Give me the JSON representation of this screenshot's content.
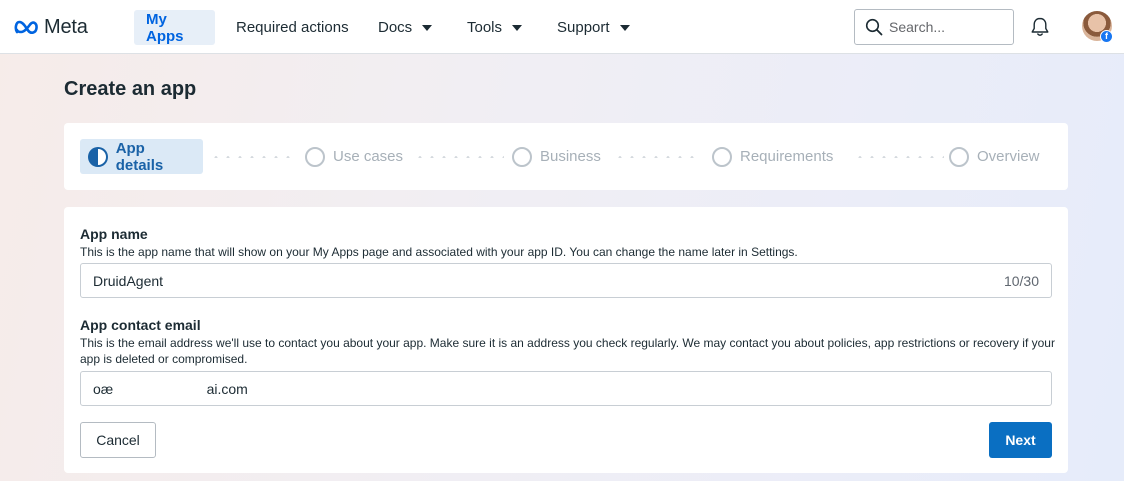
{
  "topnav": {
    "logo_text": "Meta",
    "items": [
      {
        "label": "My Apps"
      },
      {
        "label": "Required actions"
      },
      {
        "label": "Docs"
      },
      {
        "label": "Tools"
      },
      {
        "label": "Support"
      }
    ],
    "search_placeholder": "Search...",
    "icons": {
      "search": "search-icon",
      "bell": "bell-icon",
      "avatar": "avatar",
      "badge": "facebook-icon"
    },
    "badge_text": "f"
  },
  "page": {
    "title": "Create an app"
  },
  "stepper": {
    "steps": [
      {
        "label": "App details",
        "state": "active"
      },
      {
        "label": "Use cases",
        "state": "pending"
      },
      {
        "label": "Business",
        "state": "pending"
      },
      {
        "label": "Requirements",
        "state": "pending"
      },
      {
        "label": "Overview",
        "state": "pending"
      }
    ]
  },
  "form": {
    "app_name": {
      "label": "App name",
      "help": "This is the app name that will show on your My Apps page and associated with your app ID. You can change the name later in Settings.",
      "value": "DruidAgent",
      "counter": "10/30"
    },
    "contact_email": {
      "label": "App contact email",
      "help": "This is the email address we'll use to contact you about your app. Make sure it is an address you check regularly. We may contact you about policies, app restrictions or recovery if your app is deleted or compromised.",
      "value": "oæ                        ai.com"
    },
    "cancel_label": "Cancel",
    "next_label": "Next"
  },
  "colors": {
    "accent": "#0a6fc2",
    "active_step_bg": "#dbe9f6",
    "nav_active_bg": "#e7eff8"
  }
}
